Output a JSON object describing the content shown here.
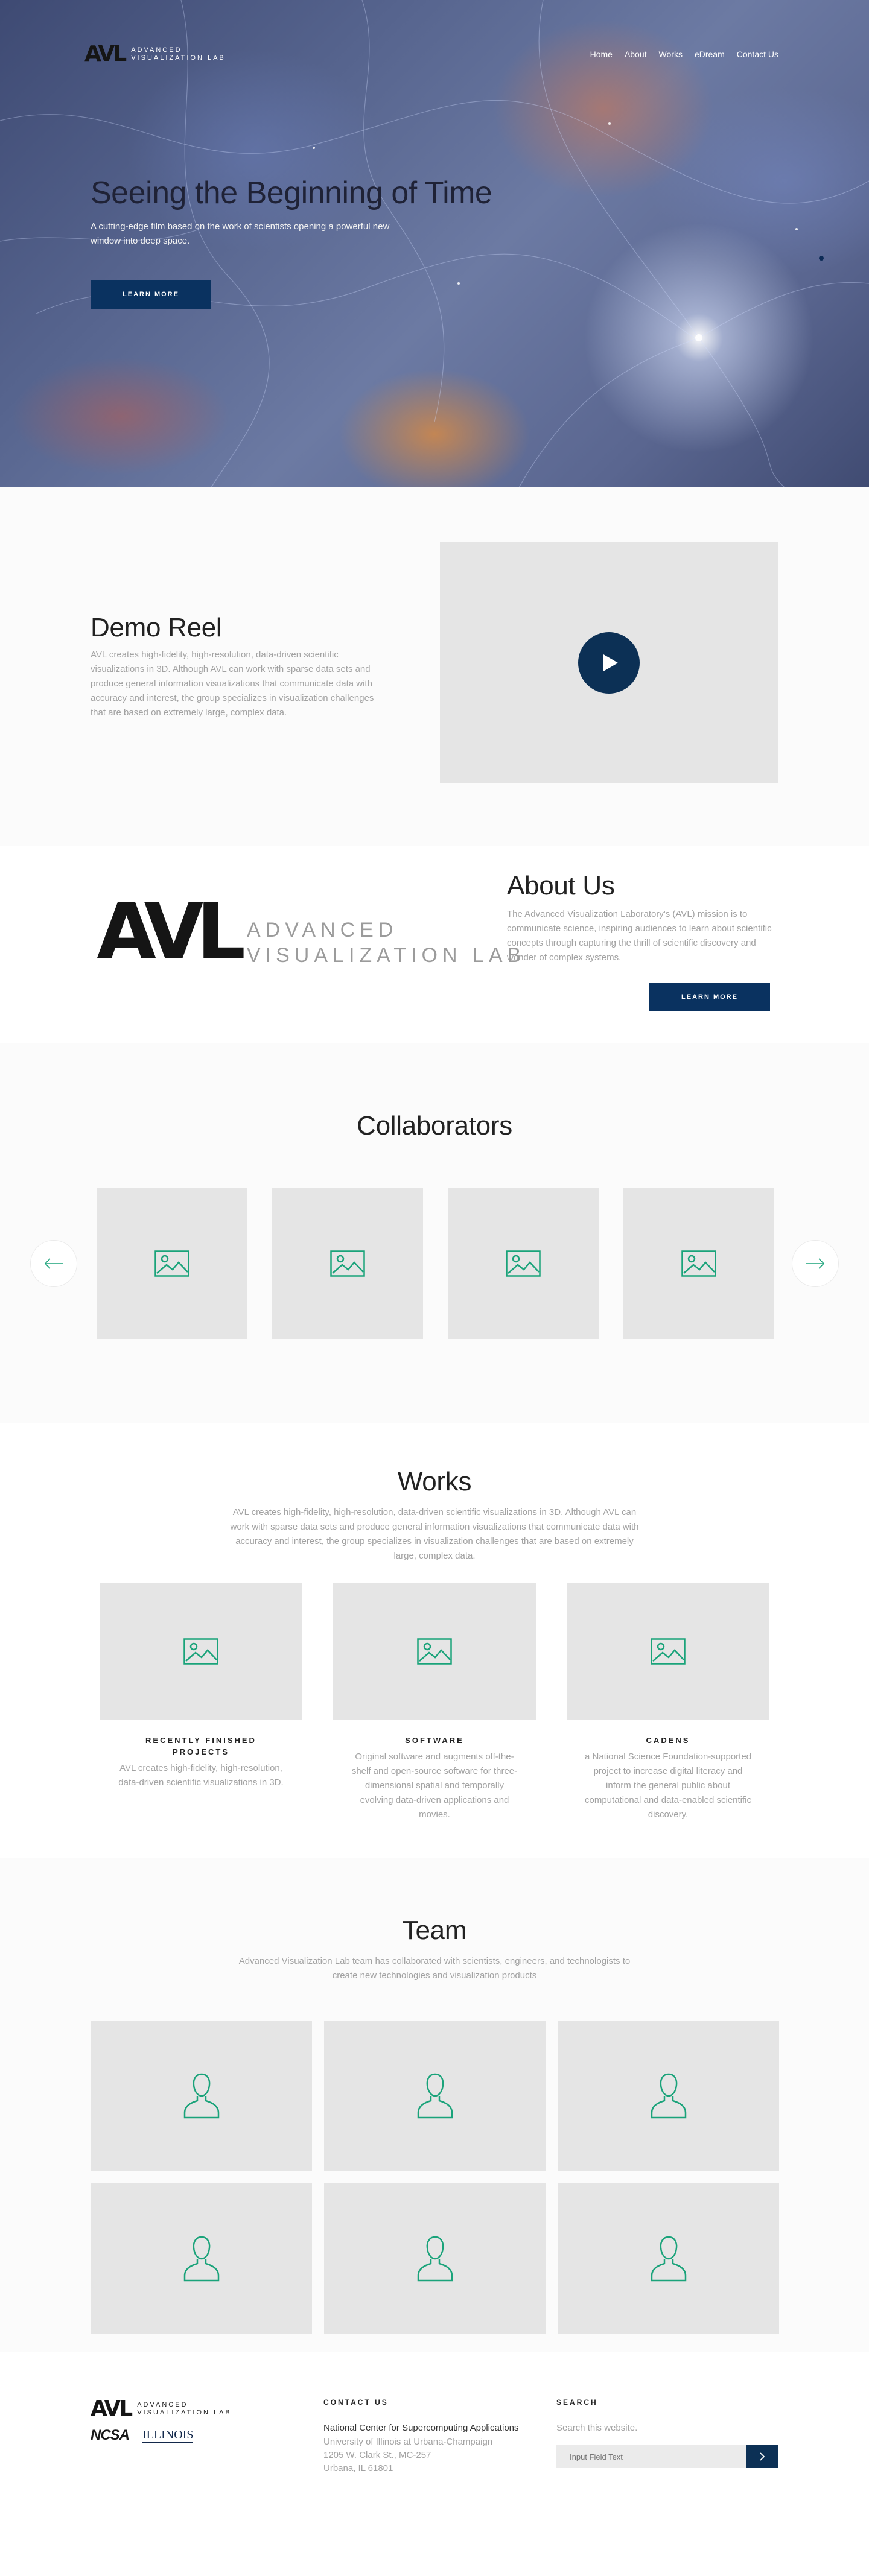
{
  "brand": {
    "logo_mark": "AVL",
    "logo_line1": "ADVANCED",
    "logo_line2": "VISUALIZATION LAB"
  },
  "nav": {
    "items": [
      "Home",
      "About",
      "Works",
      "eDream",
      "Contact Us"
    ]
  },
  "hero": {
    "title": "Seeing the Beginning of Time",
    "subtitle": "A cutting-edge film based on the work of scientists opening a powerful new window into deep space.",
    "button": "LEARN MORE"
  },
  "demo": {
    "title": "Demo Reel",
    "body": "AVL creates high-fidelity, high-resolution, data-driven scientific visualizations in 3D. Although AVL can work with sparse data sets and produce general information visualizations that communicate data with accuracy and interest, the group specializes in visualization challenges that are based on extremely large, complex data."
  },
  "about": {
    "title": "About Us",
    "body": "The Advanced Visualization Laboratory's (AVL) mission is to communicate science, inspiring audiences to learn about scientific concepts through capturing the thrill of scientific discovery and wonder of complex systems.",
    "button": "LEARN MORE"
  },
  "collaborators": {
    "title": "Collaborators"
  },
  "works": {
    "title": "Works",
    "intro": "AVL creates high-fidelity, high-resolution, data-driven scientific visualizations in 3D. Although AVL can work with sparse data sets and produce general information visualizations that communicate data with accuracy and interest, the group specializes in visualization challenges that are based on extremely large, complex data.",
    "items": [
      {
        "title": "RECENTLY FINISHED PROJECTS",
        "desc": "AVL creates high-fidelity, high-resolution, data-driven scientific visualizations in 3D."
      },
      {
        "title": "SOFTWARE",
        "desc": "Original software and augments off-the-shelf and open-source software for three-dimensional spatial and temporally evolving data-driven applications and movies."
      },
      {
        "title": "CADENS",
        "desc": "a National Science Foundation-supported project to increase digital literacy and inform the general public about computational and data-enabled scientific discovery."
      }
    ]
  },
  "team": {
    "title": "Team",
    "intro": "Advanced Visualization Lab team has collaborated with scientists, engineers, and technologists to create new technologies and visualization products"
  },
  "footer": {
    "partner1": "NCSA",
    "partner2": "ILLINOIS",
    "contact_title": "CONTACT US",
    "contact_org": "National Center for Supercomputing Applications",
    "contact_line1": "University of Illinois at Urbana-Champaign",
    "contact_line2": "1205 W. Clark St., MC-257",
    "contact_line3": "Urbana, IL 61801",
    "search_title": "SEARCH",
    "search_label": "Search this website.",
    "search_placeholder": "Input Field Text"
  },
  "colors": {
    "primary": "#0a3260",
    "accent_icon": "#1aa37a",
    "tile_bg": "#e5e5e5",
    "text_grey": "#a2a2a2"
  },
  "icons": {
    "image_placeholder": "image-icon",
    "person_placeholder": "person-icon",
    "play": "play-icon",
    "arrow_left": "arrow-left-icon",
    "arrow_right": "arrow-right-icon",
    "search_submit": "chevron-right-icon"
  }
}
